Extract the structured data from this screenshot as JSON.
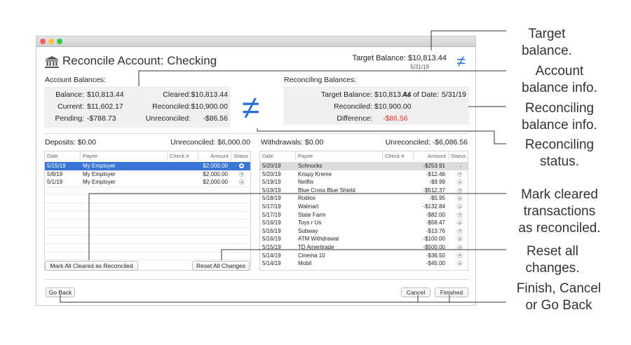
{
  "window": {
    "title": "Reconcile Account: Checking",
    "target_balance_text": "Target Balance:  $10,813.44",
    "target_date": "5/31/19",
    "not_equal_symbol": "≠"
  },
  "account_balances": {
    "title": "Account Balances:",
    "balance_label": "Balance:",
    "balance": "$10,813.44",
    "current_label": "Current:",
    "current": "$11,602.17",
    "pending_label": "Pending:",
    "pending": "-$788.73",
    "cleared_label": "Cleared:",
    "cleared": "$10,813.44",
    "reconciled_label": "Reconciled:",
    "reconciled": "$10,900.00",
    "unreconciled_label": "Unreconciled:",
    "unreconciled": "-$86.56"
  },
  "reconciling_balances": {
    "title": "Reconciling Balances:",
    "target_label": "Target Balance:",
    "target": "$10,813.44",
    "asof_label": "As of Date:",
    "asof": "5/31/19",
    "reconciled_label": "Reconciled:",
    "reconciled": "$10,900.00",
    "difference_label": "Difference:",
    "difference": "-$86.56",
    "difference_color": "#e8322b"
  },
  "deposits": {
    "label": "Deposits:  $0.00",
    "unreconciled": "Unreconciled:  $6,000.00",
    "columns": [
      "Date",
      "Payee",
      "Check #",
      "Amount",
      "Status"
    ],
    "rows": [
      {
        "date": "5/15/19",
        "payee": "My Employer",
        "check": "",
        "amount": "$2,000.00"
      },
      {
        "date": "5/8/19",
        "payee": "My Employer",
        "check": "",
        "amount": "$2,000.00"
      },
      {
        "date": "5/1/19",
        "payee": "My Employer",
        "check": "",
        "amount": "$2,000.00"
      }
    ]
  },
  "withdrawals": {
    "label": "Withdrawals:  $0.00",
    "unreconciled": "Unreconciled:  -$6,086.56",
    "columns": [
      "Date",
      "Payee",
      "Check #",
      "Amount",
      "Status"
    ],
    "rows": [
      {
        "date": "5/20/19",
        "payee": "Schnucks",
        "check": "",
        "amount": "-$253.91"
      },
      {
        "date": "5/20/19",
        "payee": "Krispy Kreme",
        "check": "",
        "amount": "-$12.46"
      },
      {
        "date": "5/19/19",
        "payee": "Netflix",
        "check": "",
        "amount": "-$9.99"
      },
      {
        "date": "5/19/19",
        "payee": "Blue Cross Blue Shield",
        "check": "",
        "amount": "-$512.37"
      },
      {
        "date": "5/18/19",
        "payee": "Roblox",
        "check": "",
        "amount": "-$5.95"
      },
      {
        "date": "5/17/19",
        "payee": "Walmart",
        "check": "",
        "amount": "-$132.84"
      },
      {
        "date": "5/17/19",
        "payee": "State Farm",
        "check": "",
        "amount": "-$82.00"
      },
      {
        "date": "5/16/19",
        "payee": "Toys r Us",
        "check": "",
        "amount": "-$56.47"
      },
      {
        "date": "5/16/19",
        "payee": "Subway",
        "check": "",
        "amount": "-$13.76"
      },
      {
        "date": "5/16/19",
        "payee": "ATM Withdrawal",
        "check": "",
        "amount": "-$100.00"
      },
      {
        "date": "5/15/19",
        "payee": "TD Ameritrade",
        "check": "",
        "amount": "-$500.00"
      },
      {
        "date": "5/14/19",
        "payee": "Cinema 10",
        "check": "",
        "amount": "-$36.50"
      },
      {
        "date": "5/14/19",
        "payee": "Mobil",
        "check": "",
        "amount": "-$45.00"
      }
    ]
  },
  "buttons": {
    "mark_all": "Mark All Cleared as Reconciled",
    "reset_all": "Reset All Changes",
    "go_back": "Go Back",
    "cancel": "Cancel",
    "finished": "Finished"
  },
  "annotations": {
    "target_1": "Target",
    "target_2": "balance.",
    "account_1": "Account",
    "account_2": "balance info.",
    "reconciling_1": "Reconciling",
    "reconciling_2": "balance info.",
    "status_1": "Reconciling",
    "status_2": "status.",
    "mark_1": "Mark cleared",
    "mark_2": "transactions",
    "mark_3": "as reconciled.",
    "reset_1": "Reset all",
    "reset_2": "changes.",
    "finish_1": "Finish, Cancel",
    "finish_2": "or Go Back"
  },
  "colors": {
    "accent": "#2a6fd1",
    "selection": "#3875d7",
    "negative": "#e8322b"
  }
}
